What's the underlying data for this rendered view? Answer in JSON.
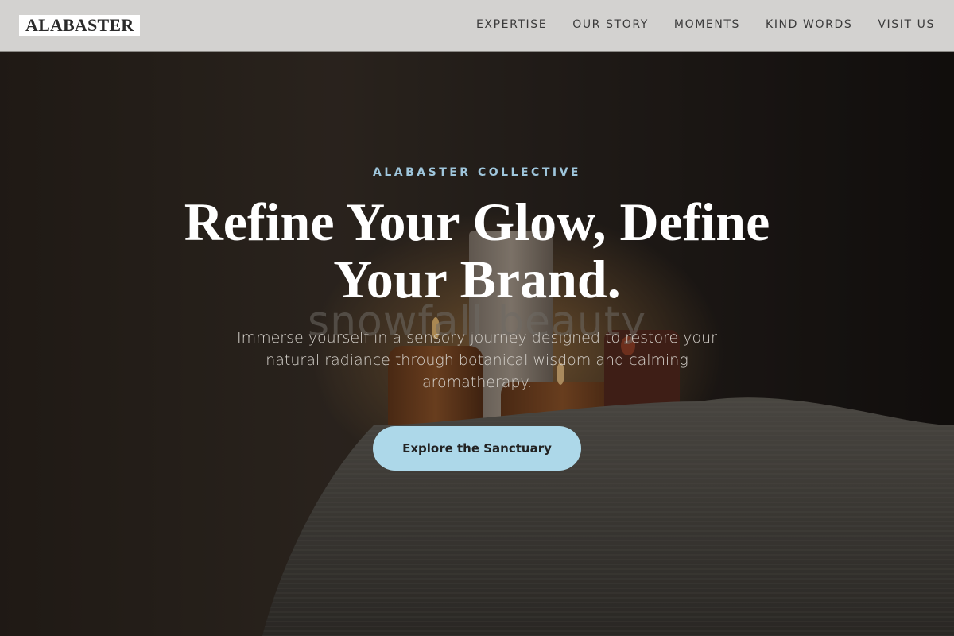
{
  "header": {
    "logo": "ALABASTER",
    "nav": [
      "EXPERTISE",
      "OUR STORY",
      "MOMENTS",
      "KIND WORDS",
      "VISIT US"
    ]
  },
  "hero": {
    "eyebrow": "ALABASTER COLLECTIVE",
    "title": "Refine Your Glow, Define Your Brand.",
    "watermark": "snowfall beauty",
    "subtitle": "Immerse yourself in a sensory journey designed to restore your natural radiance through botanical wisdom and calming aromatherapy.",
    "cta_label": "Explore the Sanctuary"
  },
  "colors": {
    "header_bg": "#d3d2d0",
    "accent": "#add8e9",
    "eyebrow": "#9fc6dc",
    "hero_overlay": "#1a1613"
  }
}
